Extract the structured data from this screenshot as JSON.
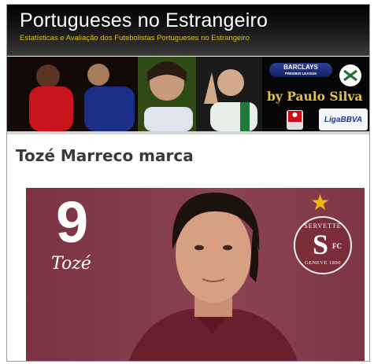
{
  "header": {
    "title": "Portugueses no Estrangeiro",
    "tagline": "Estatísticas e Avaliação dos Futebolistas Portugueses no Estrangeiro",
    "background_color": "#000000",
    "tagline_color": "#d9c21a"
  },
  "banner": {
    "byline": "by Paulo Silva",
    "logos": {
      "epl": "BARCLAYS",
      "epl_sub": "PREMIER LEAGUE",
      "bundesliga": "BUNDES LIGA",
      "lfp": "LigaBBVA"
    }
  },
  "post": {
    "title": "Tozé Marreco marca",
    "image": {
      "shirt_number": "9",
      "shirt_name": "Tozé",
      "club_crest_top": "SERVETTE",
      "club_crest_letter": "S",
      "club_crest_fc": "FC",
      "club_crest_bottom": "GENEVE 1890",
      "background_color": "#8a4251",
      "star_color": "#f1b417"
    }
  }
}
